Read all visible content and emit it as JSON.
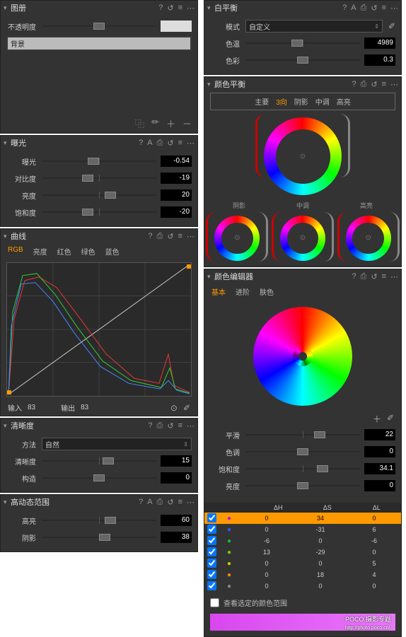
{
  "left": {
    "album": {
      "title": "图册",
      "opacity_label": "不透明度",
      "layer": "背景"
    },
    "exposure": {
      "title": "曝光",
      "rows": [
        {
          "label": "曝光",
          "value": "-0.54",
          "pos": 45
        },
        {
          "label": "对比度",
          "value": "-19",
          "pos": 40
        },
        {
          "label": "亮度",
          "value": "20",
          "pos": 60
        },
        {
          "label": "饱和度",
          "value": "-20",
          "pos": 40
        }
      ]
    },
    "curves": {
      "title": "曲线",
      "tabs": [
        "RGB",
        "亮度",
        "红色",
        "绿色",
        "蓝色"
      ],
      "input_label": "输入",
      "input_value": "83",
      "output_label": "输出",
      "output_value": "83"
    },
    "clarity": {
      "title": "清晰度",
      "method_label": "方法",
      "method_value": "自然",
      "rows": [
        {
          "label": "清晰度",
          "value": "15",
          "pos": 58
        },
        {
          "label": "构造",
          "value": "0",
          "pos": 50
        }
      ]
    },
    "hdr": {
      "title": "高动态范围",
      "rows": [
        {
          "label": "高亮",
          "value": "60",
          "pos": 60
        },
        {
          "label": "阴影",
          "value": "38",
          "pos": 55
        }
      ]
    }
  },
  "right": {
    "wb": {
      "title": "白平衡",
      "mode_label": "模式",
      "mode_value": "自定义",
      "rows": [
        {
          "label": "色温",
          "value": "4989",
          "pos": 45
        },
        {
          "label": "色彩",
          "value": "0.3",
          "pos": 50
        }
      ]
    },
    "cb": {
      "title": "颜色平衡",
      "tabs": [
        "主要",
        "3向",
        "阴影",
        "中调",
        "高亮"
      ],
      "wheel_labels": [
        "阴影",
        "中调",
        "高亮"
      ]
    },
    "ce": {
      "title": "颜色编辑器",
      "tabs": [
        "基本",
        "进阶",
        "肤色"
      ],
      "rows": [
        {
          "label": "平滑",
          "value": "22",
          "pos": 65
        },
        {
          "label": "色调",
          "value": "0",
          "pos": 50
        },
        {
          "label": "饱和度",
          "value": "34.1",
          "pos": 67
        },
        {
          "label": "亮度",
          "value": "0",
          "pos": 50
        }
      ],
      "headers": [
        "ΔH",
        "ΔS",
        "ΔL"
      ],
      "data": [
        {
          "color": "#c0f",
          "h": "0",
          "s": "34",
          "l": "0",
          "hl": true
        },
        {
          "color": "#35f",
          "h": "0",
          "s": "-31",
          "l": "6",
          "hl": false
        },
        {
          "color": "#0c3",
          "h": "-6",
          "s": "0",
          "l": "-6",
          "hl": false
        },
        {
          "color": "#7c0",
          "h": "13",
          "s": "-29",
          "l": "0",
          "hl": false
        },
        {
          "color": "#cc0",
          "h": "0",
          "s": "0",
          "l": "5",
          "hl": false
        },
        {
          "color": "#f80",
          "h": "0",
          "s": "18",
          "l": "4",
          "hl": false
        },
        {
          "color": "#888",
          "h": "0",
          "s": "0",
          "l": "0",
          "hl": false
        }
      ],
      "checkbox_label": "查看选定的颜色范围",
      "logo": "POCO 摄影专题",
      "logo_url": "http://photo.poco.cn/"
    }
  }
}
